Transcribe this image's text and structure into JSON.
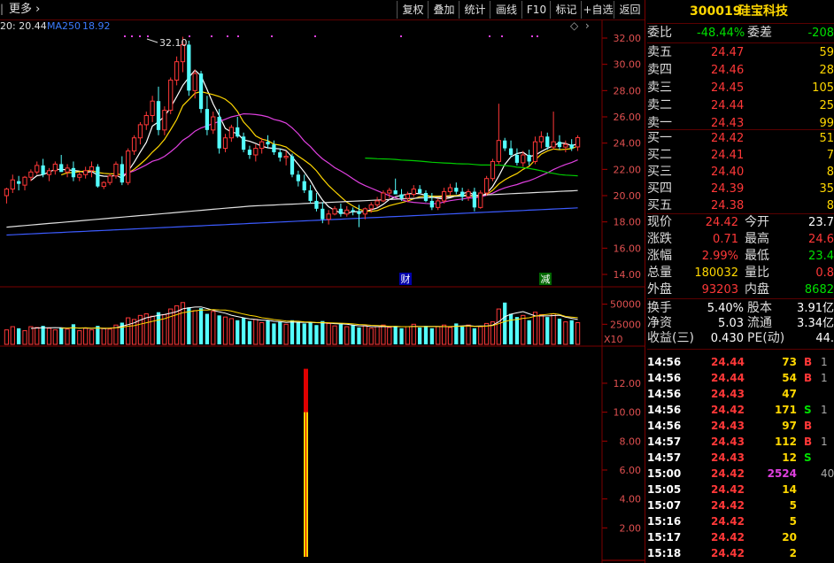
{
  "toolbar": {
    "more_label": "更多",
    "buttons": [
      "复权",
      "叠加",
      "统计",
      "画线",
      "F10",
      "标记",
      "+自选",
      "返回"
    ]
  },
  "ma_legend": {
    "ma_prefix": "20: 20.44",
    "ma250_label": "MA250",
    "ma250_value": "18.92",
    "diamond_icon": "diamond-icon",
    "chevron_icon": "chevron-right-icon"
  },
  "stock": {
    "code": "300019",
    "name": "硅宝科技"
  },
  "order_book": {
    "weibi_label": "委比",
    "weibi_value": "-48.44%",
    "weicha_label": "委差",
    "weicha_value": "-208",
    "sells": [
      {
        "label": "卖五",
        "price": "24.47",
        "vol": "59"
      },
      {
        "label": "卖四",
        "price": "24.46",
        "vol": "28"
      },
      {
        "label": "卖三",
        "price": "24.45",
        "vol": "105"
      },
      {
        "label": "卖二",
        "price": "24.44",
        "vol": "25"
      },
      {
        "label": "卖一",
        "price": "24.43",
        "vol": "99"
      }
    ],
    "buys": [
      {
        "label": "买一",
        "price": "24.42",
        "vol": "51"
      },
      {
        "label": "买二",
        "price": "24.41",
        "vol": "7"
      },
      {
        "label": "买三",
        "price": "24.40",
        "vol": "8"
      },
      {
        "label": "买四",
        "price": "24.39",
        "vol": "35"
      },
      {
        "label": "买五",
        "price": "24.38",
        "vol": "8"
      }
    ]
  },
  "quote": [
    {
      "l1": "现价",
      "v1": "24.42",
      "c1": "#ff3838",
      "l2": "今开",
      "v2": "23.7",
      "c2": "#ffffff"
    },
    {
      "l1": "涨跌",
      "v1": "0.71",
      "c1": "#ff3838",
      "l2": "最高",
      "v2": "24.6",
      "c2": "#ff3838"
    },
    {
      "l1": "涨幅",
      "v1": "2.99%",
      "c1": "#ff3838",
      "l2": "最低",
      "v2": "23.4",
      "c2": "#00e000"
    },
    {
      "l1": "总量",
      "v1": "180032",
      "c1": "#ffd700",
      "l2": "量比",
      "v2": "0.8",
      "c2": "#ff3838"
    },
    {
      "l1": "外盘",
      "v1": "93203",
      "c1": "#ff3838",
      "l2": "内盘",
      "v2": "8682",
      "c2": "#00e000"
    }
  ],
  "stats": [
    {
      "l1": "换手",
      "v1": "5.40%",
      "l2": "股本",
      "v2": "3.91亿"
    },
    {
      "l1": "净资",
      "v1": "5.03",
      "l2": "流通",
      "v2": "3.34亿"
    },
    {
      "l1": "收益(三)",
      "v1": "0.430",
      "l2": "PE(动)",
      "v2": "44."
    }
  ],
  "ticks": [
    {
      "time": "14:56",
      "price": "24.44",
      "vol": "73",
      "side": "B",
      "extra": "1"
    },
    {
      "time": "14:56",
      "price": "24.44",
      "vol": "54",
      "side": "B",
      "extra": "1"
    },
    {
      "time": "14:56",
      "price": "24.43",
      "vol": "47",
      "side": "",
      "extra": ""
    },
    {
      "time": "14:56",
      "price": "24.42",
      "vol": "171",
      "side": "S",
      "extra": "1"
    },
    {
      "time": "14:56",
      "price": "24.43",
      "vol": "97",
      "side": "B",
      "extra": ""
    },
    {
      "time": "14:57",
      "price": "24.43",
      "vol": "112",
      "side": "B",
      "extra": "1"
    },
    {
      "time": "14:57",
      "price": "24.43",
      "vol": "12",
      "side": "S",
      "extra": ""
    },
    {
      "time": "15:00",
      "price": "24.42",
      "vol": "2524",
      "side": "",
      "extra": "40"
    },
    {
      "time": "15:05",
      "price": "24.42",
      "vol": "14",
      "side": "",
      "extra": ""
    },
    {
      "time": "15:07",
      "price": "24.42",
      "vol": "5",
      "side": "",
      "extra": ""
    },
    {
      "time": "15:16",
      "price": "24.42",
      "vol": "5",
      "side": "",
      "extra": ""
    },
    {
      "time": "15:17",
      "price": "24.42",
      "vol": "20",
      "side": "",
      "extra": ""
    },
    {
      "time": "15:18",
      "price": "24.42",
      "vol": "2",
      "side": "",
      "extra": ""
    }
  ],
  "chart_data": [
    {
      "type": "candlestick",
      "title": "",
      "yticks": [
        "32.00",
        "30.00",
        "28.00",
        "26.00",
        "24.00",
        "22.00",
        "20.00",
        "18.00",
        "16.00",
        "14.00"
      ],
      "ylim": [
        13,
        34
      ],
      "annotations": [
        {
          "text": "32.10"
        },
        {
          "text": "财"
        },
        {
          "text": "减"
        }
      ],
      "candles": [
        [
          20.0,
          20.6,
          19.4,
          20.5
        ],
        [
          20.5,
          21.6,
          20.2,
          21.2
        ],
        [
          21.1,
          21.5,
          20.4,
          20.9
        ],
        [
          20.8,
          21.5,
          20.4,
          21.4
        ],
        [
          21.4,
          22.0,
          21.1,
          21.8
        ],
        [
          21.8,
          22.6,
          21.6,
          22.3
        ],
        [
          22.3,
          22.8,
          21.4,
          21.6
        ],
        [
          21.6,
          22.1,
          21.1,
          21.9
        ],
        [
          21.9,
          22.6,
          21.6,
          22.4
        ],
        [
          22.4,
          23.1,
          22.1,
          21.8
        ],
        [
          21.8,
          22.4,
          21.4,
          22.1
        ],
        [
          22.1,
          22.6,
          21.1,
          21.4
        ],
        [
          21.4,
          21.8,
          21.1,
          21.6
        ],
        [
          21.6,
          22.2,
          21.3,
          21.9
        ],
        [
          21.9,
          22.6,
          21.4,
          22.2
        ],
        [
          22.2,
          22.4,
          20.6,
          20.7
        ],
        [
          20.7,
          21.1,
          20.5,
          21.0
        ],
        [
          21.0,
          21.7,
          20.8,
          21.5
        ],
        [
          21.5,
          22.6,
          21.3,
          22.4
        ],
        [
          22.4,
          23.0,
          20.8,
          21.0
        ],
        [
          21.0,
          23.6,
          20.8,
          23.4
        ],
        [
          23.4,
          24.6,
          23.1,
          24.4
        ],
        [
          24.4,
          25.6,
          23.9,
          25.4
        ],
        [
          25.4,
          26.4,
          25.0,
          26.1
        ],
        [
          26.1,
          27.6,
          25.6,
          27.2
        ],
        [
          27.2,
          28.3,
          24.6,
          25.0
        ],
        [
          25.0,
          26.8,
          24.6,
          26.5
        ],
        [
          26.5,
          29.0,
          26.2,
          28.8
        ],
        [
          28.8,
          30.6,
          28.4,
          30.2
        ],
        [
          30.2,
          32.1,
          29.4,
          31.5
        ],
        [
          31.5,
          31.8,
          27.6,
          28.0
        ],
        [
          28.0,
          29.6,
          27.4,
          29.3
        ],
        [
          29.3,
          29.5,
          26.3,
          26.6
        ],
        [
          26.6,
          27.6,
          24.6,
          25.0
        ],
        [
          25.0,
          26.4,
          24.7,
          26.0
        ],
        [
          26.0,
          26.6,
          23.2,
          23.6
        ],
        [
          23.6,
          24.7,
          23.3,
          24.4
        ],
        [
          24.4,
          25.4,
          24.1,
          25.2
        ],
        [
          25.2,
          26.0,
          24.4,
          24.5
        ],
        [
          24.5,
          24.8,
          23.3,
          23.5
        ],
        [
          23.5,
          23.8,
          22.8,
          23.1
        ],
        [
          23.1,
          23.9,
          22.6,
          23.6
        ],
        [
          23.6,
          24.4,
          23.2,
          24.1
        ],
        [
          24.1,
          24.6,
          23.6,
          23.9
        ],
        [
          23.9,
          24.2,
          23.1,
          23.3
        ],
        [
          23.3,
          23.6,
          22.6,
          22.9
        ],
        [
          22.9,
          23.4,
          22.3,
          23.0
        ],
        [
          23.0,
          23.2,
          21.4,
          21.6
        ],
        [
          21.6,
          21.9,
          20.7,
          21.1
        ],
        [
          21.1,
          21.6,
          20.2,
          20.4
        ],
        [
          20.4,
          20.8,
          19.4,
          19.6
        ],
        [
          19.6,
          20.2,
          18.8,
          19.0
        ],
        [
          19.0,
          19.5,
          17.9,
          18.2
        ],
        [
          18.2,
          18.9,
          17.8,
          18.6
        ],
        [
          18.6,
          19.2,
          18.5,
          19.0
        ],
        [
          19.0,
          19.4,
          18.4,
          18.6
        ],
        [
          18.6,
          19.2,
          18.4,
          18.9
        ],
        [
          18.9,
          19.1,
          18.5,
          18.8
        ],
        [
          18.8,
          19.3,
          17.6,
          18.6
        ],
        [
          18.6,
          19.1,
          18.2,
          19.0
        ],
        [
          19.0,
          19.5,
          18.7,
          19.3
        ],
        [
          19.3,
          19.9,
          19.1,
          19.6
        ],
        [
          19.6,
          20.4,
          19.5,
          20.2
        ],
        [
          20.2,
          20.6,
          19.8,
          20.4
        ],
        [
          20.4,
          21.3,
          20.2,
          20.1
        ],
        [
          20.1,
          20.5,
          19.6,
          19.8
        ],
        [
          19.8,
          20.3,
          19.5,
          20.1
        ],
        [
          20.1,
          20.8,
          19.9,
          20.5
        ],
        [
          20.5,
          20.8,
          20.1,
          20.2
        ],
        [
          20.2,
          20.4,
          19.5,
          19.6
        ],
        [
          19.6,
          20.2,
          18.9,
          19.1
        ],
        [
          19.1,
          19.8,
          18.9,
          19.6
        ],
        [
          19.6,
          20.6,
          19.4,
          20.3
        ],
        [
          20.3,
          20.9,
          20.0,
          20.6
        ],
        [
          20.6,
          21.0,
          20.1,
          20.3
        ],
        [
          20.3,
          20.6,
          19.6,
          19.9
        ],
        [
          19.9,
          20.5,
          19.6,
          20.3
        ],
        [
          20.3,
          20.6,
          18.8,
          19.1
        ],
        [
          19.1,
          20.4,
          19.0,
          20.2
        ],
        [
          20.2,
          21.5,
          20.0,
          21.3
        ],
        [
          21.3,
          22.8,
          21.1,
          22.6
        ],
        [
          22.6,
          27.0,
          22.4,
          24.2
        ],
        [
          24.2,
          24.4,
          23.4,
          23.6
        ],
        [
          23.6,
          24.2,
          22.9,
          23.1
        ],
        [
          23.1,
          23.6,
          22.3,
          22.5
        ],
        [
          22.5,
          23.4,
          22.2,
          23.1
        ],
        [
          23.1,
          23.5,
          22.3,
          22.6
        ],
        [
          22.6,
          24.5,
          22.4,
          24.1
        ],
        [
          24.1,
          24.9,
          23.6,
          24.5
        ],
        [
          24.5,
          24.8,
          23.5,
          23.7
        ],
        [
          23.7,
          26.4,
          23.5,
          24.1
        ],
        [
          24.1,
          24.6,
          23.5,
          23.7
        ],
        [
          23.7,
          24.2,
          23.3,
          23.9
        ],
        [
          23.9,
          24.3,
          23.4,
          23.6
        ],
        [
          23.71,
          24.6,
          23.4,
          24.42
        ]
      ]
    },
    {
      "type": "bar",
      "title": "",
      "yticks": [
        "50000",
        "25000"
      ],
      "unit": "X10",
      "values": [
        18000,
        22000,
        20000,
        17000,
        22000,
        21000,
        23000,
        20000,
        18000,
        21000,
        19000,
        25000,
        17000,
        20000,
        18000,
        23000,
        20000,
        19000,
        24000,
        27000,
        33000,
        31000,
        36000,
        38000,
        35000,
        40000,
        37000,
        44000,
        48000,
        52000,
        46000,
        42000,
        45000,
        38000,
        41000,
        36000,
        34000,
        32000,
        30000,
        33000,
        29000,
        31000,
        27000,
        30000,
        26000,
        28000,
        25000,
        30000,
        28000,
        26000,
        27000,
        24000,
        29000,
        26000,
        23000,
        25000,
        22000,
        24000,
        21000,
        23000,
        20000,
        22000,
        24000,
        21000,
        23000,
        20000,
        22000,
        25000,
        21000,
        23000,
        20000,
        22000,
        24000,
        21000,
        26000,
        22000,
        24000,
        20000,
        22000,
        26000,
        28000,
        44000,
        52000,
        38000,
        34000,
        36000,
        30000,
        40000,
        37000,
        34000,
        38000,
        32000,
        28000,
        30000,
        27000
      ],
      "ylim": [
        0,
        65000
      ]
    },
    {
      "type": "bar",
      "title": "",
      "yticks": [
        "12.00",
        "10.00",
        "8.00",
        "6.00",
        "4.00",
        "2.00"
      ],
      "values": [
        13.0
      ],
      "ylim": [
        0,
        14.2
      ]
    }
  ]
}
